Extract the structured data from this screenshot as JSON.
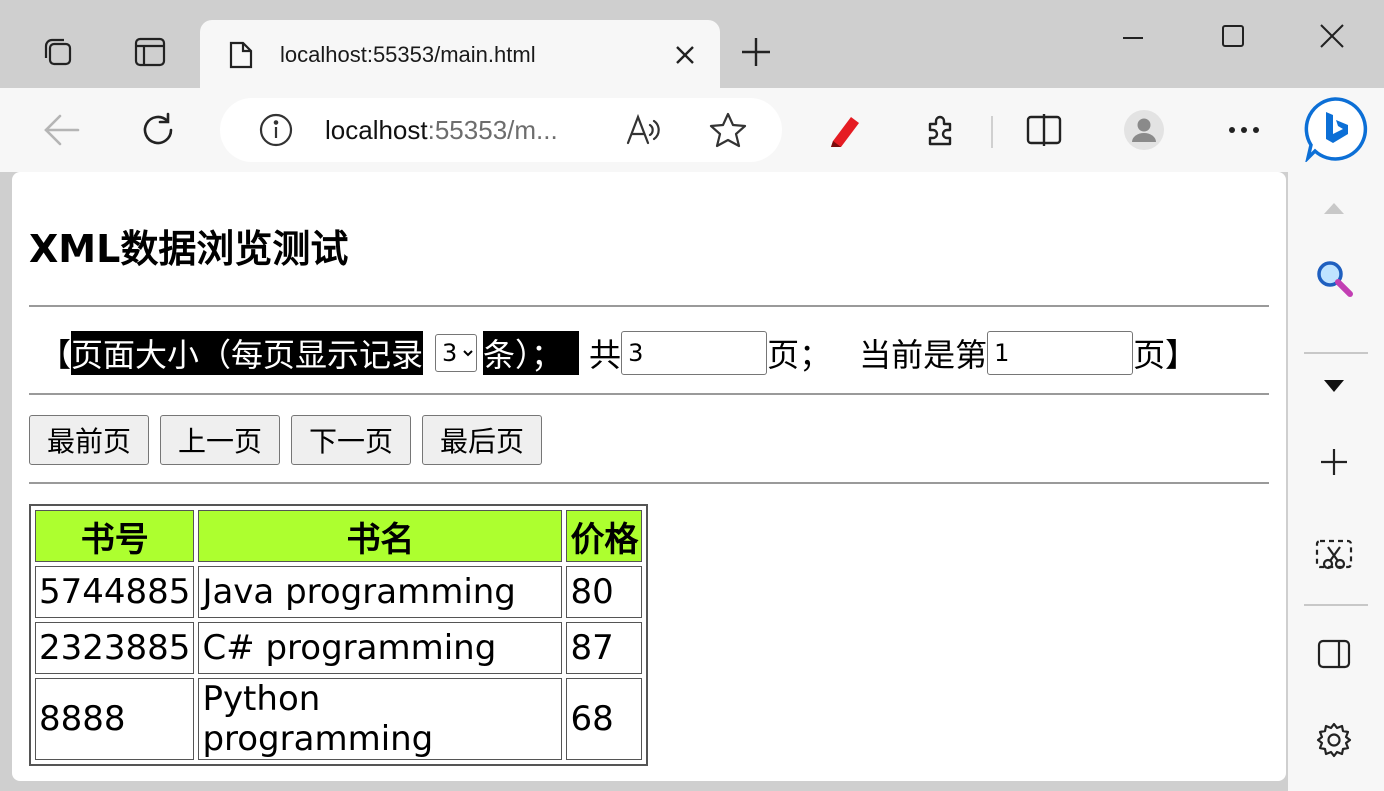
{
  "window": {
    "tab_title": "localhost:55353/main.html",
    "minimize_label": "",
    "address_host": "localhost",
    "address_rest": ":55353/m..."
  },
  "page": {
    "title": "XML数据浏览测试",
    "pager": {
      "open_bracket": "【",
      "page_size_prefix": "页面大小（每页显示记录",
      "page_size_selected": "3",
      "page_size_options": [
        "3"
      ],
      "page_size_suffix": "条）；",
      "total_prefix": "共",
      "total_pages": "3",
      "total_suffix": "页；",
      "current_prefix": "当前是第",
      "current_page": "1",
      "current_suffix": "页】"
    },
    "buttons": {
      "first": "最前页",
      "prev": "上一页",
      "next": "下一页",
      "last": "最后页"
    },
    "table": {
      "headers": [
        "书号",
        "书名",
        "价格"
      ],
      "rows": [
        [
          "5744885",
          "Java programming",
          "80"
        ],
        [
          "2323885",
          "C# programming",
          "87"
        ],
        [
          "8888",
          "Python programming",
          "68"
        ]
      ]
    }
  },
  "colors": {
    "header_bg": "#adff2f",
    "highlight_bg": "#000000",
    "browser_accent": "#0c6fd6"
  }
}
